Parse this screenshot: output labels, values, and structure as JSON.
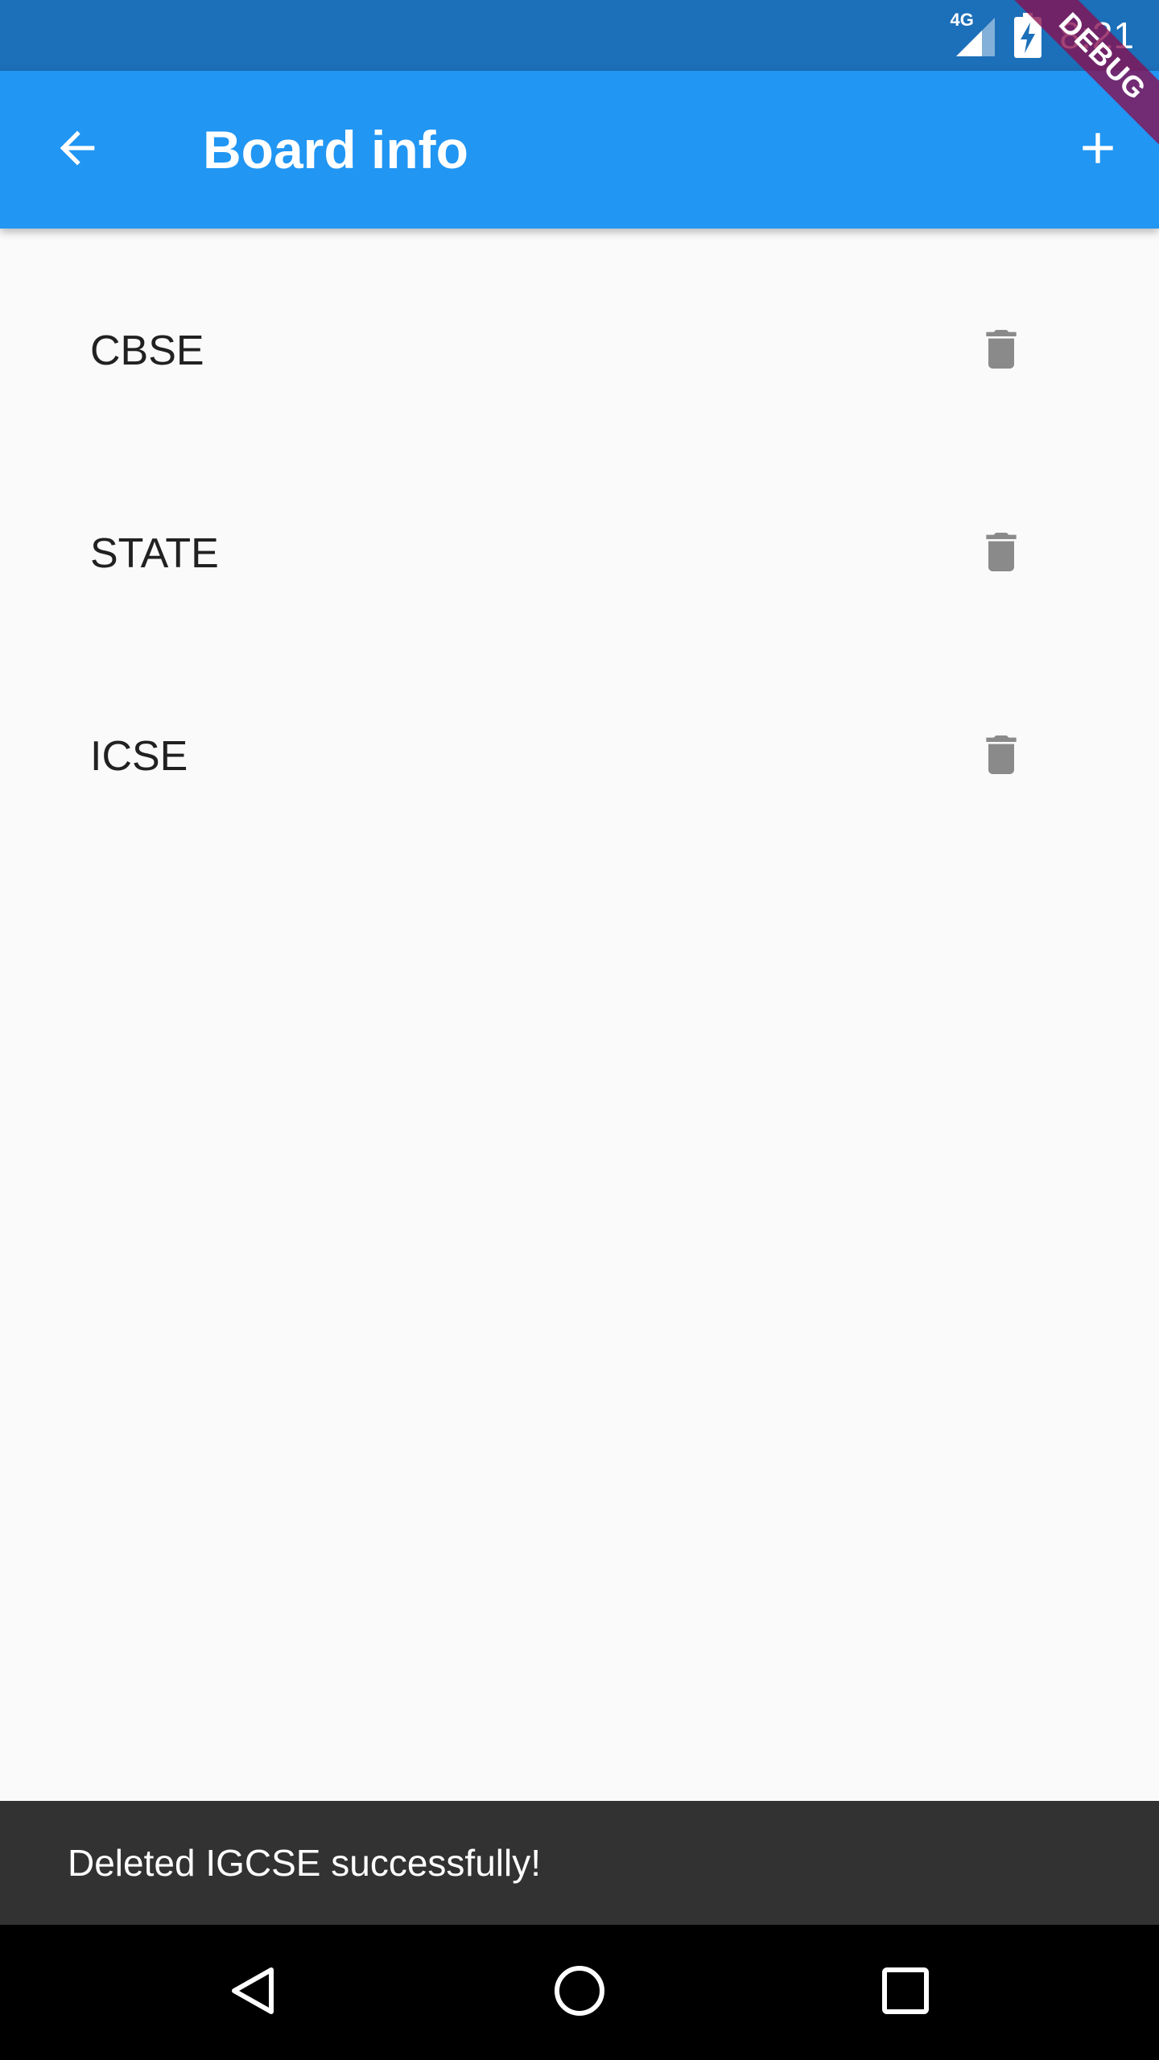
{
  "status_bar": {
    "network_type": "4G",
    "time": "8:21",
    "debug_banner": "DEBUG"
  },
  "app_bar": {
    "title": "Board info",
    "back_icon": "arrow-back-icon",
    "add_icon": "add-icon"
  },
  "boards": [
    {
      "name": "CBSE"
    },
    {
      "name": "STATE"
    },
    {
      "name": "ICSE"
    }
  ],
  "snackbar": {
    "message": "Deleted IGCSE successfully!"
  },
  "nav_bar": {
    "back_icon": "nav-back-icon",
    "home_icon": "nav-home-icon",
    "recents_icon": "nav-recents-icon"
  },
  "colors": {
    "status_bar": "#1C6FB9",
    "app_bar": "#2196F3",
    "background": "#FAFAFA",
    "delete_icon": "#8A8A8A",
    "snackbar": "#323232"
  }
}
